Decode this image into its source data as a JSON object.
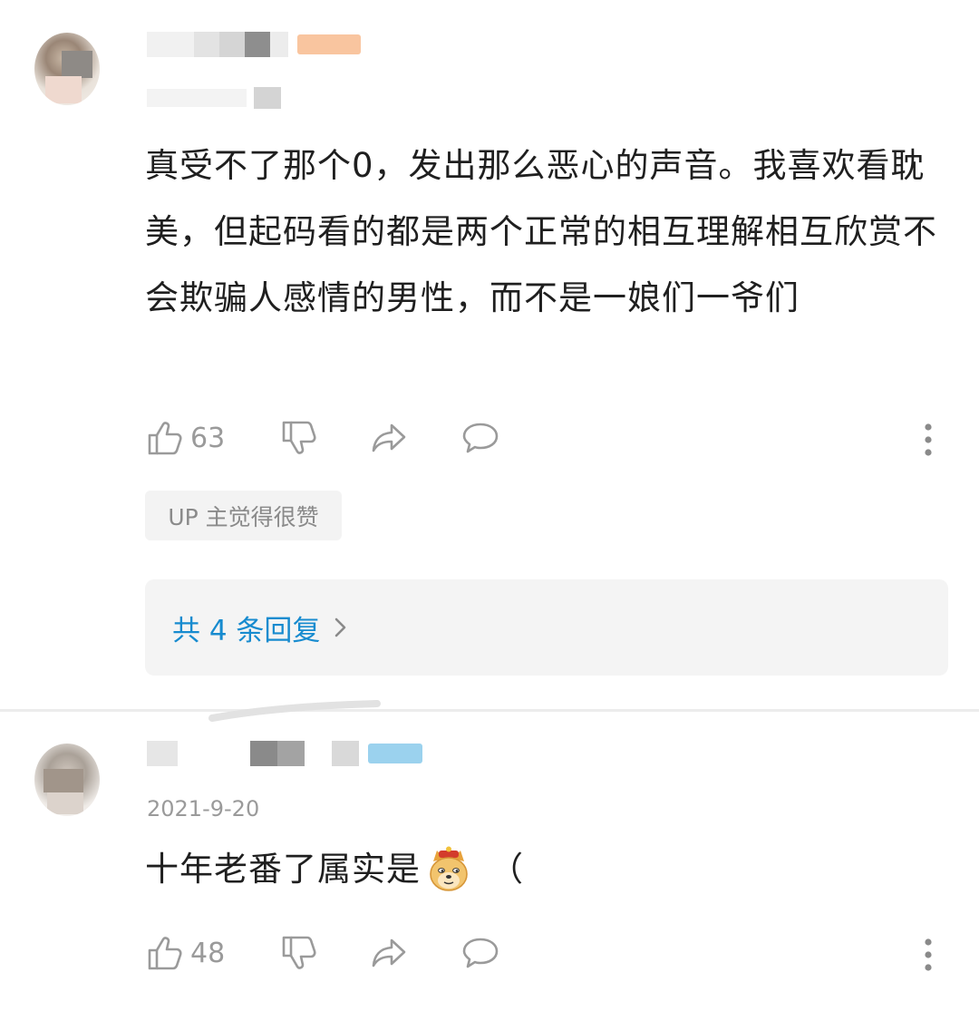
{
  "comments": [
    {
      "text": "真受不了那个0，发出那么恶心的声音。我喜欢看耽美，但起码看的都是两个正常的相互理解相互欣赏不会欺骗人感情的男性，而不是一娘们一爷们",
      "likes": "63",
      "badge": "UP 主觉得很赞",
      "replies_label": "共 4 条回复",
      "icons": [
        "thumbs-up-icon",
        "thumbs-down-icon",
        "share-icon",
        "comment-icon",
        "more-icon"
      ]
    },
    {
      "date": "2021-9-20",
      "text": "十年老番了属实是",
      "text_tail": "（",
      "likes": "48",
      "icons": [
        "thumbs-up-icon",
        "thumbs-down-icon",
        "share-icon",
        "comment-icon",
        "more-icon",
        "doge-emoji-icon"
      ]
    }
  ],
  "colors": {
    "accent_link": "#178bcf",
    "text_primary": "#1f1f1f",
    "text_secondary": "#9a9a9a",
    "badge_bg": "#f3f3f3",
    "replies_bg": "#f4f4f4"
  }
}
